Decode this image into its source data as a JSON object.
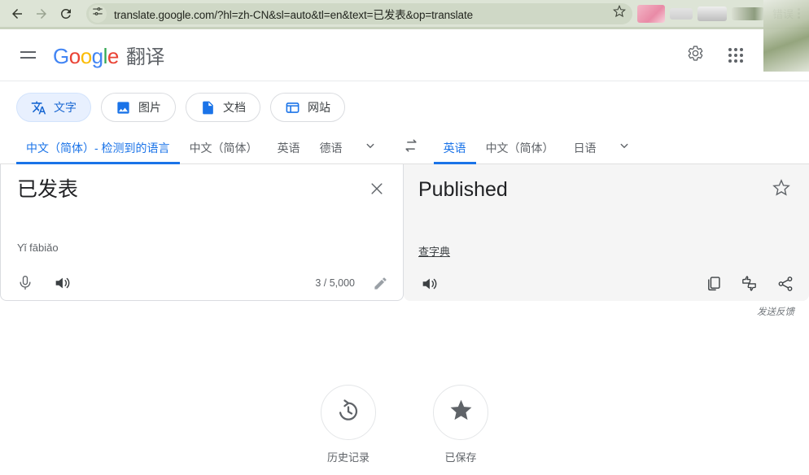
{
  "browser": {
    "back_icon": "arrow-left-icon",
    "forward_icon": "arrow-right-icon",
    "reload_icon": "reload-icon",
    "site_settings_icon": "tune-sliders-icon",
    "url": "translate.google.com/?hl=zh-CN&sl=auto&tl=en&text=已发表&op=translate",
    "bookmark_icon": "star-outline-icon",
    "extension_label": "错误",
    "menu_icon": "kebab-menu-icon"
  },
  "header": {
    "menu_icon": "hamburger-menu-icon",
    "logo": {
      "g1": "G",
      "o1": "o",
      "o2": "o",
      "g2": "g",
      "l": "l",
      "e": "e"
    },
    "product_name": "翻译",
    "settings_icon": "gear-icon",
    "apps_icon": "apps-grid-icon"
  },
  "mode_tabs": [
    {
      "label": "文字",
      "icon": "translate-text-icon",
      "active": true
    },
    {
      "label": "图片",
      "icon": "image-icon",
      "active": false
    },
    {
      "label": "文档",
      "icon": "document-icon",
      "active": false
    },
    {
      "label": "网站",
      "icon": "website-icon",
      "active": false
    }
  ],
  "source_languages": {
    "items": [
      {
        "label": "中文（简体）- 检测到的语言",
        "selected": true
      },
      {
        "label": "中文（简体）",
        "selected": false
      },
      {
        "label": "英语",
        "selected": false
      },
      {
        "label": "德语",
        "selected": false
      }
    ],
    "more_icon": "chevron-down-icon"
  },
  "swap_icon": "swap-horizontal-icon",
  "target_languages": {
    "items": [
      {
        "label": "英语",
        "selected": true
      },
      {
        "label": "中文（简体）",
        "selected": false
      },
      {
        "label": "日语",
        "selected": false
      }
    ],
    "more_icon": "chevron-down-icon"
  },
  "source_pane": {
    "text": "已发表",
    "pinyin": "Yǐ fābiǎo",
    "char_count": "3 / 5,000",
    "clear_icon": "close-icon",
    "mic_icon": "microphone-icon",
    "speaker_icon": "speaker-icon",
    "edit_icon": "pencil-icon"
  },
  "target_pane": {
    "text": "Published",
    "dictionary_link": "查字典",
    "star_icon": "star-outline-icon",
    "speaker_icon": "speaker-icon",
    "copy_icon": "copy-icon",
    "rate_icon": "thumbs-up-down-icon",
    "share_icon": "share-icon"
  },
  "feedback": {
    "label": "发送反馈"
  },
  "bottom_actions": [
    {
      "label": "历史记录",
      "icon": "history-clock-icon"
    },
    {
      "label": "已保存",
      "icon": "star-filled-icon"
    }
  ],
  "colors": {
    "brand_blue": "#1a73e8",
    "chrome_bg": "#dde4d6",
    "pane_dst_bg": "#f5f5f5",
    "tab_active_bg": "#e8f0fe"
  }
}
